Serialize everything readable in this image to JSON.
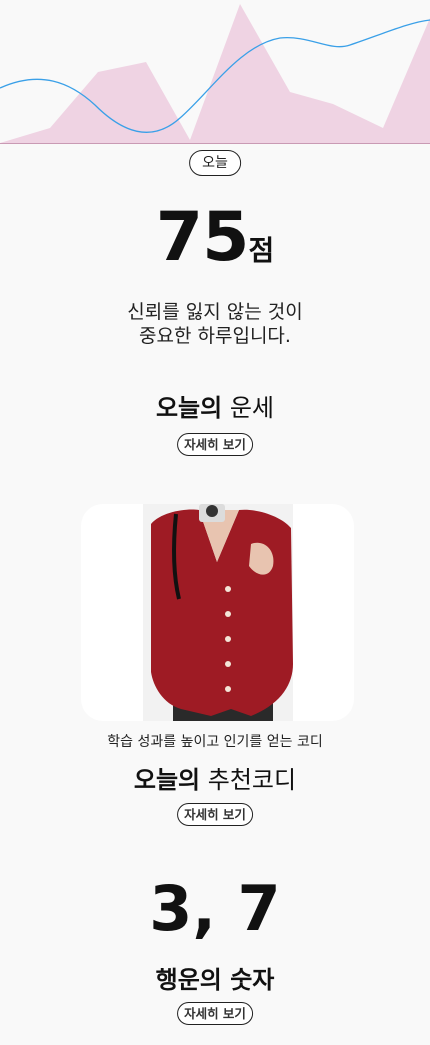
{
  "header": {
    "today_label": "오늘"
  },
  "score": {
    "value": "75",
    "unit": "점"
  },
  "fortune": {
    "line1": "신뢰를 잃지 않는 것이",
    "line2": "중요한 하루입니다.",
    "title_bold": "오늘의",
    "title_rest": " 운세",
    "detail_button": "자세히 보기"
  },
  "outfit": {
    "subtitle": "학습 성과를 높이고 인기를 얻는 코디",
    "title_bold": "오늘의",
    "title_rest": " 추천코디",
    "detail_button": "자세히 보기"
  },
  "lucky": {
    "numbers": "3, 7",
    "title": "행운의 숫자",
    "detail_button": "자세히 보기"
  },
  "colors": {
    "chart_fill": "#efd3e3",
    "chart_line": "#3aa0e8",
    "sweater": "#9e1b24"
  }
}
